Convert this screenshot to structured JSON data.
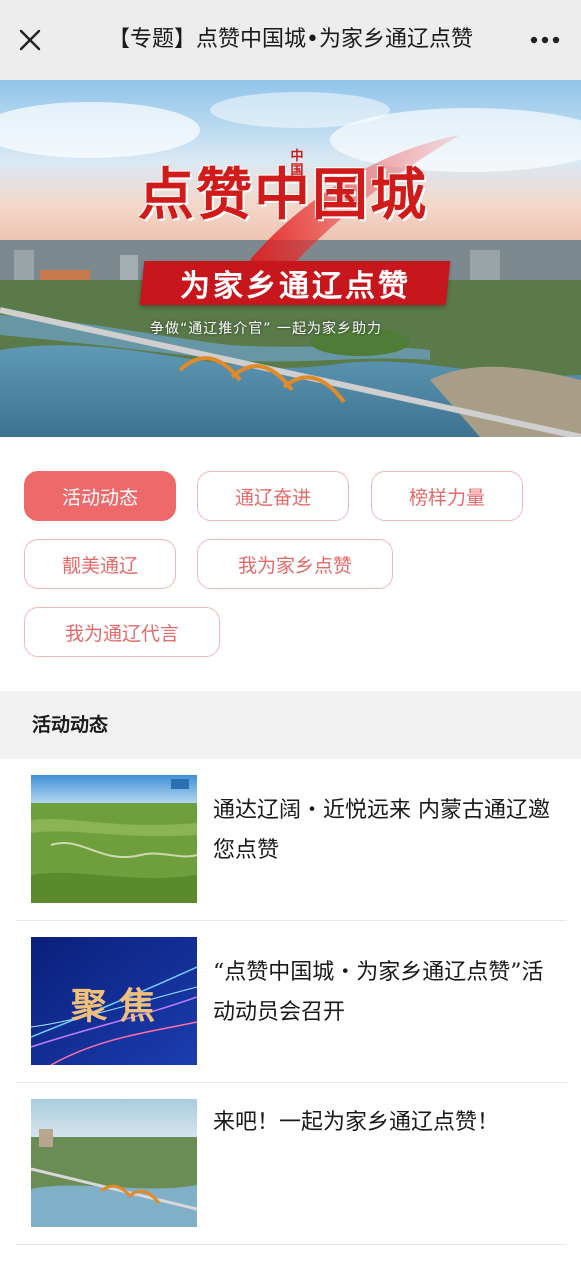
{
  "header": {
    "title": "【专题】点赞中国城•为家乡通辽点赞",
    "close_icon": "close-icon",
    "more_icon": "more-dots-icon"
  },
  "banner": {
    "main_title": "点赞中国城",
    "mark": "中国",
    "ribbon_text": "为家乡通辽点赞",
    "tagline": "争做“通辽推介官”   一起为家乡助力"
  },
  "tags": [
    {
      "label": "活动动态",
      "active": true
    },
    {
      "label": "通辽奋进",
      "active": false
    },
    {
      "label": "榜样力量",
      "active": false
    },
    {
      "label": "靓美通辽",
      "active": false
    },
    {
      "label": "我为家乡点赞",
      "active": false
    },
    {
      "label": "我为通辽代言",
      "active": false
    }
  ],
  "section": {
    "title": "活动动态"
  },
  "articles": [
    {
      "title": "通达辽阔・近悦远来  内蒙古通辽邀您点赞",
      "thumb": "grassland"
    },
    {
      "title": "“点赞中国城・为家乡通辽点赞”活动动员会召开",
      "thumb_label": "聚焦"
    },
    {
      "title": "来吧！一起为家乡通辽点赞！",
      "thumb": "river-bridge"
    }
  ],
  "colors": {
    "accent": "#ee6a6a",
    "tag_border": "#f2b8b8",
    "tag_text": "#e46a6a",
    "banner_red": "#c8161d"
  }
}
